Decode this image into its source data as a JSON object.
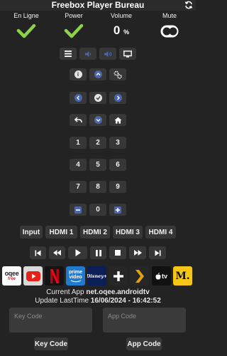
{
  "header": {
    "title": "Freebox Player Bureau",
    "refresh_icon": "refresh-icon"
  },
  "status": {
    "online_label": "En Ligne",
    "power_label": "Power",
    "volume_label": "Volume",
    "mute_label": "Mute",
    "volume_value": "0",
    "volume_unit": "%",
    "online_state": true,
    "power_state": true,
    "mute_state": false,
    "check_color": "#8bd14a"
  },
  "sources": {
    "input": "Input",
    "hdmi1": "HDMI 1",
    "hdmi2": "HDMI 2",
    "hdmi3": "HDMI 3",
    "hdmi4": "HDMI 4"
  },
  "numpad": [
    "1",
    "2",
    "3",
    "4",
    "5",
    "6",
    "7",
    "8",
    "9",
    "0"
  ],
  "apps": {
    "oqee_label": "oqee",
    "oqee_sub": "free",
    "prime_label": "prime video",
    "disney_label": "Disney+",
    "appletv_label": "tv",
    "molotov_label": "M."
  },
  "info": {
    "current_app_label": "Current App",
    "current_app_value": "net.oqee.androidtv",
    "update_label": "Update LastTime",
    "update_value": "16/06/2024 - 16:42:52"
  },
  "codes": {
    "key_placeholder": "Key Code",
    "app_placeholder": "App Code",
    "key_button": "Key Code",
    "app_button": "App Code"
  },
  "colors": {
    "accent_blue": "#4b66ad",
    "button_bg": "#373737",
    "background": "#232323"
  }
}
